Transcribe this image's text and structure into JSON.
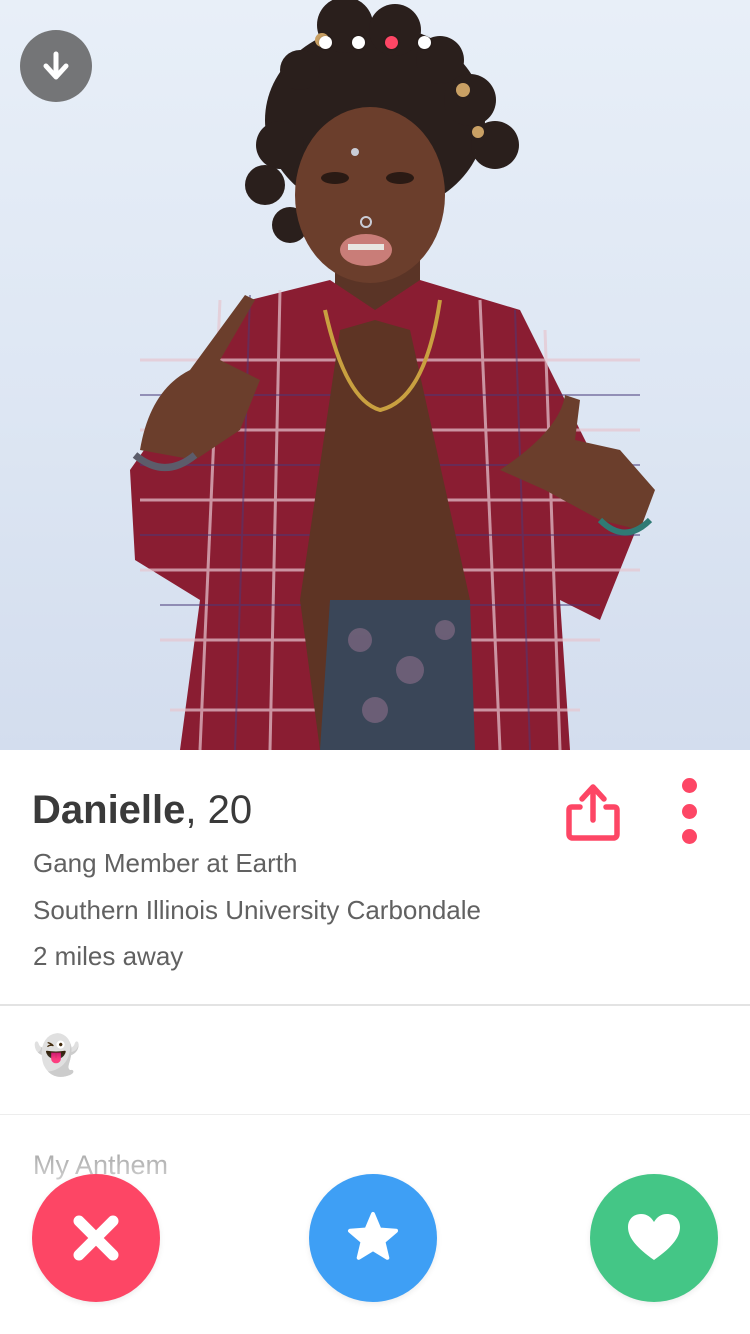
{
  "photo": {
    "indicator_count": 4,
    "active_index": 2,
    "alt_subject": "profile-photo"
  },
  "profile": {
    "name": "Danielle",
    "age": ", 20",
    "job": "Gang Member at Earth",
    "school": "Southern Illinois University Carbondale",
    "distance": "2 miles away",
    "bio_emoji": "👻",
    "anthem_label": "My Anthem"
  },
  "icons": {
    "back": "arrow-down-icon",
    "share": "share-icon",
    "more": "more-vertical-icon",
    "nope": "close-icon",
    "superlike": "star-icon",
    "like": "heart-icon"
  },
  "colors": {
    "accent": "#fd4665",
    "superlike": "#3e9ff5",
    "like": "#44c686"
  }
}
